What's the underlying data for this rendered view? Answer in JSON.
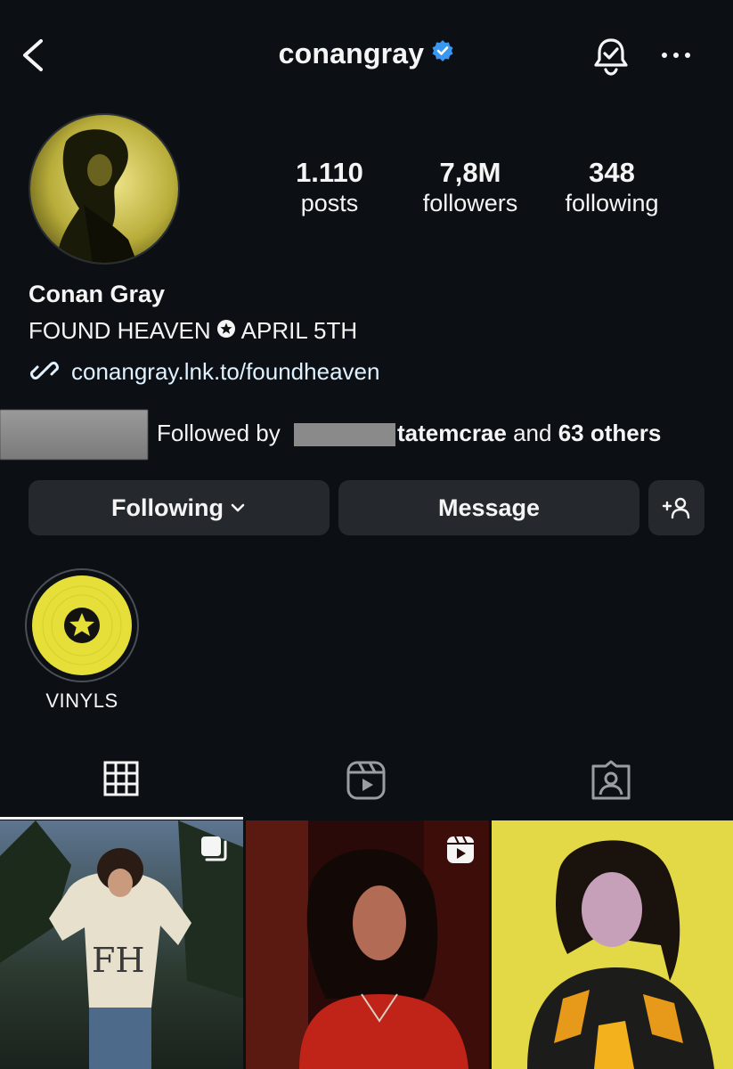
{
  "header": {
    "username": "conangray",
    "back_icon": "chevron-left-icon",
    "verified_icon": "verified-badge-icon",
    "bell_icon": "notification-bell-icon",
    "more_icon": "more-options-icon"
  },
  "profile": {
    "stats": [
      {
        "value": "1.110",
        "label": "posts"
      },
      {
        "value": "7,8M",
        "label": "followers"
      },
      {
        "value": "348",
        "label": "following"
      }
    ],
    "display_name": "Conan Gray",
    "bio_part1": "FOUND HEAVEN",
    "bio_part2": "APRIL 5TH",
    "link": "conangray.lnk.to/foundheaven",
    "followed_by_prefix": "Followed by",
    "followed_by_name": "tatemcrae",
    "followed_by_and": "and",
    "followed_by_others": "63 others"
  },
  "actions": {
    "following_label": "Following",
    "message_label": "Message",
    "add_user_icon": "add-user-icon"
  },
  "highlights": [
    {
      "label": "VINYLS",
      "icon": "vinyl-star-icon"
    }
  ],
  "tabs": [
    {
      "name": "posts-grid",
      "icon": "grid-icon",
      "active": true
    },
    {
      "name": "reels",
      "icon": "reels-icon",
      "active": false
    },
    {
      "name": "tagged",
      "icon": "tagged-icon",
      "active": false
    }
  ],
  "colors": {
    "background": "#0c1014",
    "button": "#25292e",
    "verified": "#3897f0",
    "highlight_yellow": "#e6df3a"
  }
}
